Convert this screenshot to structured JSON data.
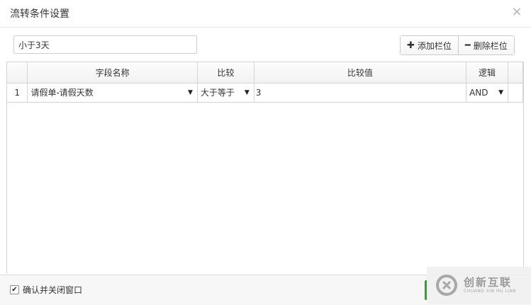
{
  "dialog": {
    "title": "流转条件设置",
    "close_glyph": "×"
  },
  "toolbar": {
    "name_value": "小于3天",
    "add_label": "添加栏位",
    "add_icon": "plus-icon",
    "delete_label": "删除栏位",
    "delete_icon": "minus-icon"
  },
  "table": {
    "columns": [
      "字段名称",
      "比较",
      "比较值",
      "逻辑"
    ],
    "rows": [
      {
        "num": "1",
        "field": "请假单-请假天数",
        "compare": "大于等于",
        "value": "3",
        "logic": "AND"
      }
    ]
  },
  "footer": {
    "checkbox_checked": true,
    "checkbox_label": "确认并关闭窗口",
    "ok_color": "#3c9a3c"
  },
  "watermark": {
    "text": "创新互联",
    "sub": "CHUANG XIN HU LIAN"
  }
}
